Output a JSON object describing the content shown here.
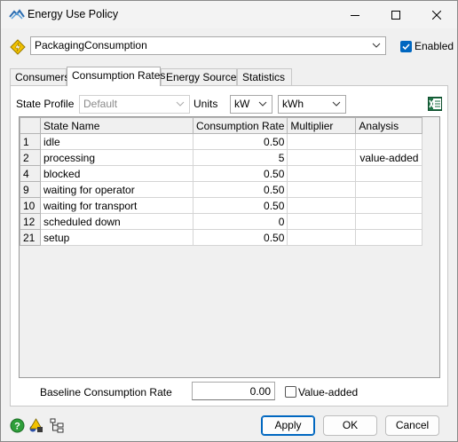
{
  "window": {
    "title": "Energy Use Policy"
  },
  "policy": {
    "name": "PackagingConsumption",
    "enabled_label": "Enabled",
    "enabled": true
  },
  "tabs": [
    {
      "label": "Consumers"
    },
    {
      "label": "Consumption Rates",
      "active": true
    },
    {
      "label": "Energy Sources"
    },
    {
      "label": "Statistics"
    }
  ],
  "rates": {
    "state_profile_label": "State Profile",
    "state_profile_value": "Default",
    "units_label": "Units",
    "power_unit": "kW",
    "energy_unit": "kWh",
    "export_icon": "excel-export-icon",
    "table": {
      "columns": [
        "State Name",
        "Consumption Rate",
        "Multiplier",
        "Analysis"
      ],
      "rows": [
        {
          "id": "1",
          "state": "idle",
          "rate": "0.50",
          "multiplier": "",
          "analysis": ""
        },
        {
          "id": "2",
          "state": "processing",
          "rate": "5",
          "multiplier": "",
          "analysis": "value-added"
        },
        {
          "id": "4",
          "state": "blocked",
          "rate": "0.50",
          "multiplier": "",
          "analysis": ""
        },
        {
          "id": "9",
          "state": "waiting for operator",
          "rate": "0.50",
          "multiplier": "",
          "analysis": ""
        },
        {
          "id": "10",
          "state": "waiting for transport",
          "rate": "0.50",
          "multiplier": "",
          "analysis": ""
        },
        {
          "id": "12",
          "state": "scheduled down",
          "rate": "0",
          "multiplier": "",
          "analysis": ""
        },
        {
          "id": "21",
          "state": "setup",
          "rate": "0.50",
          "multiplier": "",
          "analysis": ""
        }
      ]
    },
    "baseline_label": "Baseline Consumption Rate",
    "baseline_value": "0.00",
    "value_added_label": "Value-added",
    "value_added_checked": false
  },
  "buttons": {
    "apply": "Apply",
    "ok": "OK",
    "cancel": "Cancel"
  },
  "colors": {
    "accent": "#0067c0",
    "excel_green": "#1e7145"
  }
}
